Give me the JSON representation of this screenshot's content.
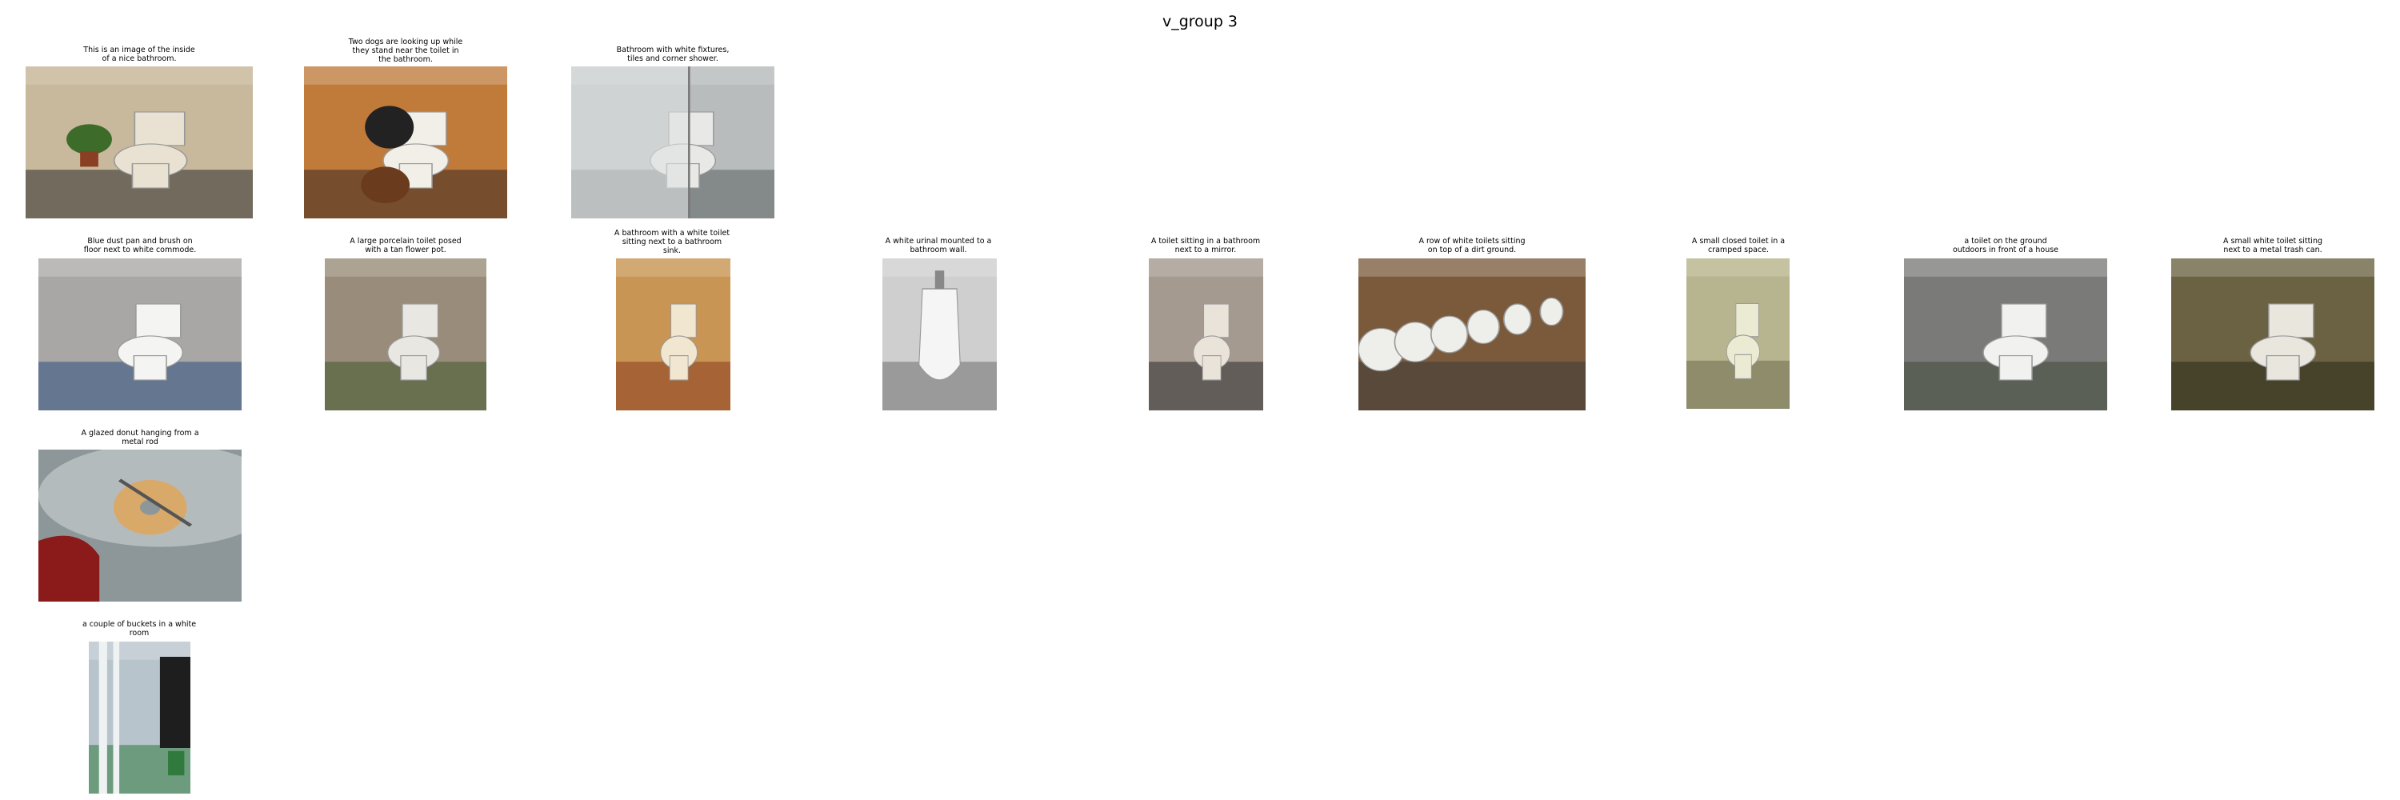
{
  "figure": {
    "title": "v_group 3"
  },
  "rows": [
    [
      {
        "caption": "This is an image of the inside\nof a nice bathroom.",
        "scene": "bathroom-plant",
        "colors": [
          "#c8b89c",
          "#e9e2d2",
          "#2a2a2a"
        ]
      },
      {
        "caption": "Two dogs are looking up while\nthey stand near the toilet in\nthe bathroom.",
        "scene": "dogs-floor",
        "colors": [
          "#c07a3a",
          "#f2efe8",
          "#3a2a22"
        ]
      },
      {
        "caption": "Bathroom with white fixtures,\ntiles and corner shower.",
        "scene": "corner-shower",
        "colors": [
          "#b9bcbd",
          "#e8e9e6",
          "#5a5e61"
        ]
      }
    ],
    [
      {
        "caption": "Blue dust pan and brush on\nfloor next to white commode.",
        "scene": "toilet-floor",
        "colors": [
          "#a9a7a6",
          "#f4f4f2",
          "#2d4f7d"
        ]
      },
      {
        "caption": "A large porcelain toilet posed\nwith a tan flower pot.",
        "scene": "outdoor-toilet",
        "colors": [
          "#9a8c7a",
          "#e9e7e1",
          "#3f5a2e"
        ]
      },
      {
        "caption": "A bathroom with a white toilet\nsitting next to a bathroom\nsink.",
        "scene": "warm-bathroom",
        "colors": [
          "#c89554",
          "#f1e6cf",
          "#8a3a1c"
        ]
      },
      {
        "caption": "A white urinal mounted to a\nbathroom wall.",
        "scene": "urinal",
        "colors": [
          "#cfcfcf",
          "#f5f5f5",
          "#6f6f6f"
        ]
      },
      {
        "caption": "A toilet sitting in a bathroom\nnext to a mirror.",
        "scene": "narrow-bathroom",
        "colors": [
          "#a59a90",
          "#e9e3da",
          "#2b2b2b"
        ]
      },
      {
        "caption": "A row of white toilets sitting\non top of a dirt ground.",
        "scene": "toilet-row",
        "colors": [
          "#7b5a3b",
          "#eeeeea",
          "#3c3c3c"
        ]
      },
      {
        "caption": "A small closed toilet in a\ncramped space.",
        "scene": "cramped-toilet",
        "colors": [
          "#b7b58f",
          "#ebebd3",
          "#6e6a4e"
        ]
      },
      {
        "caption": "a toilet on the ground\noutdoors in front of a house",
        "scene": "street-toilet",
        "colors": [
          "#7a7a78",
          "#f1f1ef",
          "#3f4a3a"
        ]
      },
      {
        "caption": "A small white toilet sitting\nnext to a metal trash can.",
        "scene": "dark-toilet",
        "colors": [
          "#6a6242",
          "#e9e6de",
          "#2a2818"
        ]
      }
    ],
    [
      {
        "caption": "A glazed donut hanging from a\nmetal rod",
        "scene": "donut-car",
        "colors": [
          "#9aa2a3",
          "#d9a96a",
          "#8b1a1a"
        ]
      }
    ],
    [
      {
        "caption": "a couple of buckets in a white\nroom",
        "scene": "pipes-room",
        "colors": [
          "#b8c4cc",
          "#eef2f3",
          "#2f7a3c"
        ]
      }
    ]
  ]
}
